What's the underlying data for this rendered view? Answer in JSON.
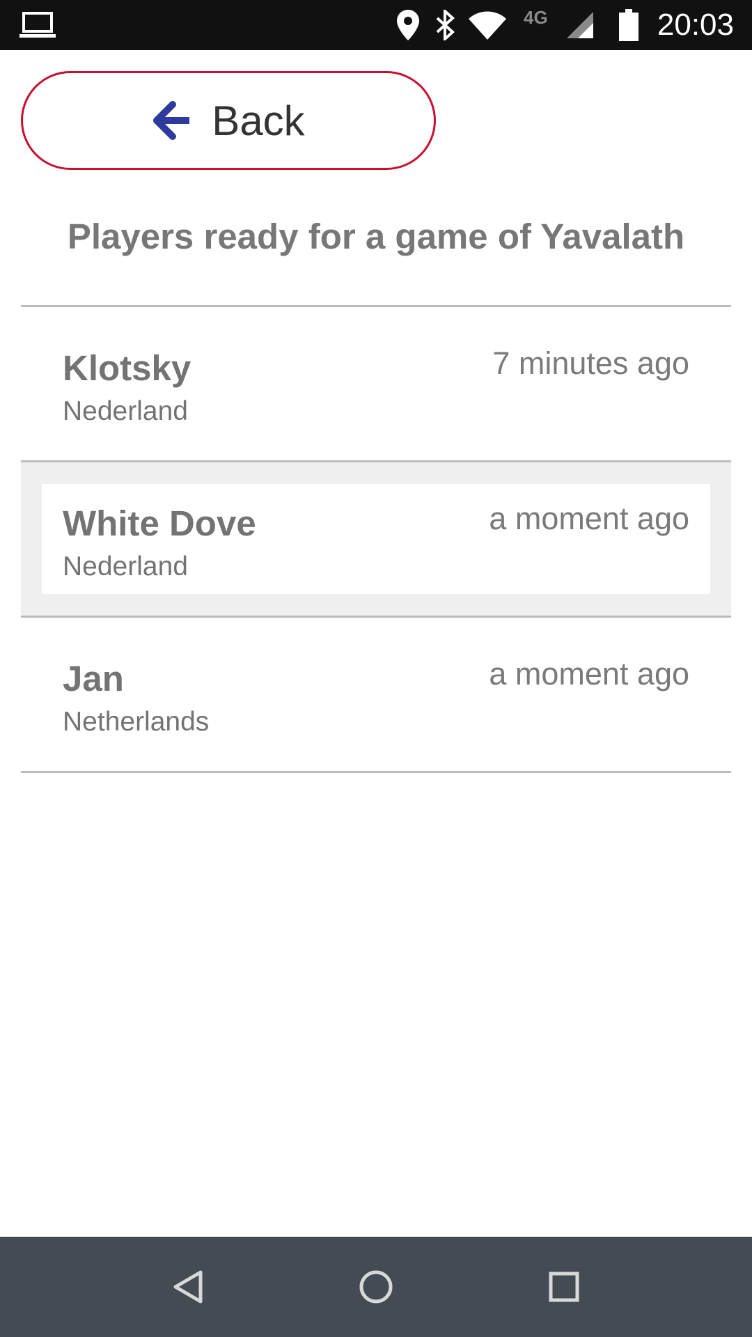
{
  "status_bar": {
    "time": "20:03",
    "network_label": "4G",
    "icons": [
      "laptop-icon",
      "location-pin-icon",
      "bluetooth-icon",
      "wifi-icon",
      "cell-signal-icon",
      "battery-icon"
    ]
  },
  "header": {
    "back_label": "Back",
    "back_icon": "arrow-left-icon",
    "title": "Players ready for a game of Yavalath"
  },
  "players": [
    {
      "name": "Klotsky",
      "country": "Nederland",
      "time": "7 minutes ago",
      "selected": false
    },
    {
      "name": "White Dove",
      "country": "Nederland",
      "time": "a moment ago",
      "selected": true
    },
    {
      "name": "Jan",
      "country": "Netherlands",
      "time": "a moment ago",
      "selected": false
    }
  ],
  "nav_bar": {
    "icons": [
      "nav-back-icon",
      "nav-home-icon",
      "nav-recents-icon"
    ]
  },
  "colors": {
    "accent_border": "#c8102e",
    "arrow": "#2e3a9e",
    "status_bar": "#111111",
    "nav_bar": "#454b52",
    "text_gray": "#777777",
    "divider": "#bbbbbb",
    "selected_bg": "#efefef"
  }
}
